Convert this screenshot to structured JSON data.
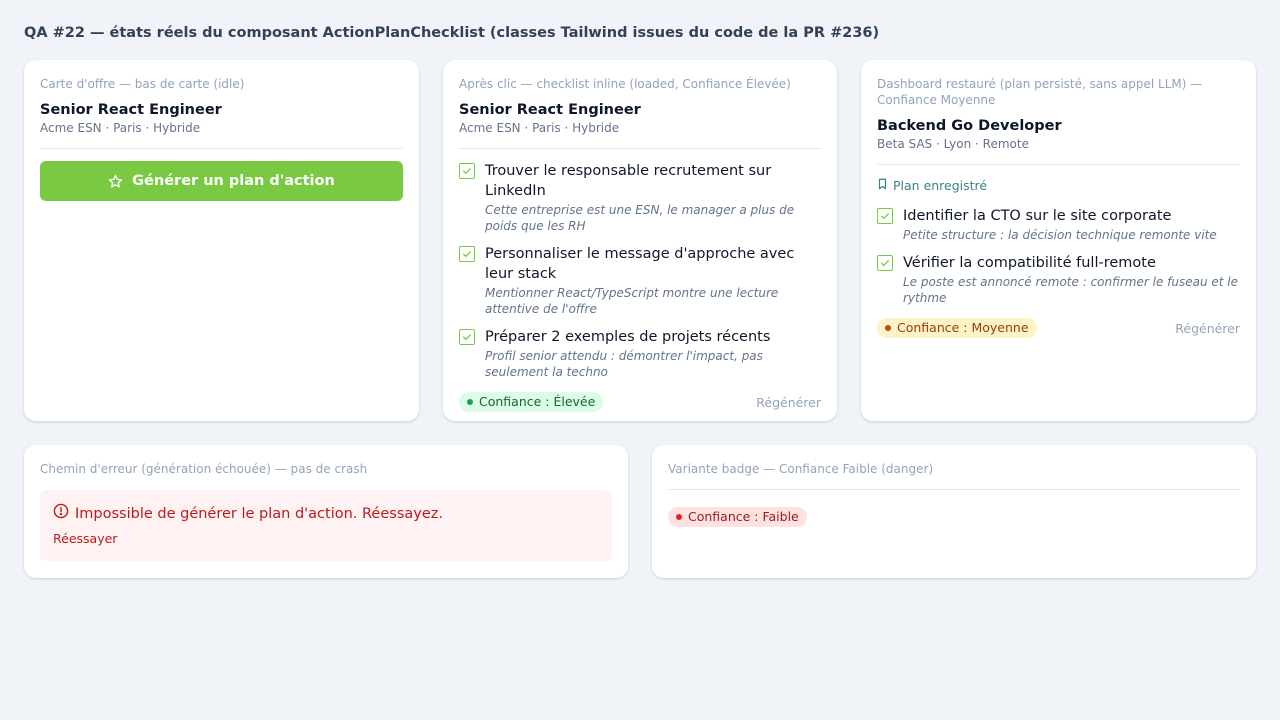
{
  "page": {
    "title": "QA #22 — états réels du composant ActionPlanChecklist (classes Tailwind issues du code de la PR #236)"
  },
  "idle_card": {
    "caption": "Carte d'offre — bas de carte (idle)",
    "job_title": "Senior React Engineer",
    "job_meta": "Acme ESN · Paris · Hybride",
    "button_label": "Générer un plan d'action",
    "button_icon": "star-icon"
  },
  "loaded_card": {
    "caption": "Après clic — checklist inline (loaded, Confiance Élevée)",
    "job_title": "Senior React Engineer",
    "job_meta": "Acme ESN · Paris · Hybride",
    "items": [
      {
        "text": "Trouver le responsable recrutement sur LinkedIn",
        "note": "Cette entreprise est une ESN, le manager a plus de poids que les RH",
        "checked": true
      },
      {
        "text": "Personnaliser le message d'approche avec leur stack",
        "note": "Mentionner React/TypeScript montre une lecture attentive de l'offre",
        "checked": true
      },
      {
        "text": "Préparer 2 exemples de projets récents",
        "note": "Profil senior attendu : démontrer l'impact, pas seulement la techno",
        "checked": true
      }
    ],
    "badge": "Confiance : Élevée",
    "regen_label": "Régénérer"
  },
  "restored_card": {
    "caption": "Dashboard restauré (plan persisté, sans appel LLM) — Confiance Moyenne",
    "job_title": "Backend Go Developer",
    "job_meta": "Beta SAS · Lyon · Remote",
    "saved_label": "Plan enregistré",
    "items": [
      {
        "text": "Identifier la CTO sur le site corporate",
        "note": "Petite structure : la décision technique remonte vite",
        "checked": true
      },
      {
        "text": "Vérifier la compatibilité full-remote",
        "note": "Le poste est annoncé remote : confirmer le fuseau et le rythme",
        "checked": true
      }
    ],
    "badge": "Confiance : Moyenne",
    "regen_label": "Régénérer"
  },
  "error_card": {
    "caption": "Chemin d'erreur (génération échouée) — pas de crash",
    "message": "Impossible de générer le plan d'action. Réessayez.",
    "retry_label": "Réessayer"
  },
  "badge_card": {
    "caption": "Variante badge — Confiance Faible (danger)",
    "badge": "Confiance : Faible"
  },
  "colors": {
    "background": "#f0f4f8",
    "accent_green": "#7ac943",
    "high": "#dcfce7",
    "medium": "#fef3c7",
    "low": "#fee2e2",
    "error_text": "#b91c1c"
  }
}
